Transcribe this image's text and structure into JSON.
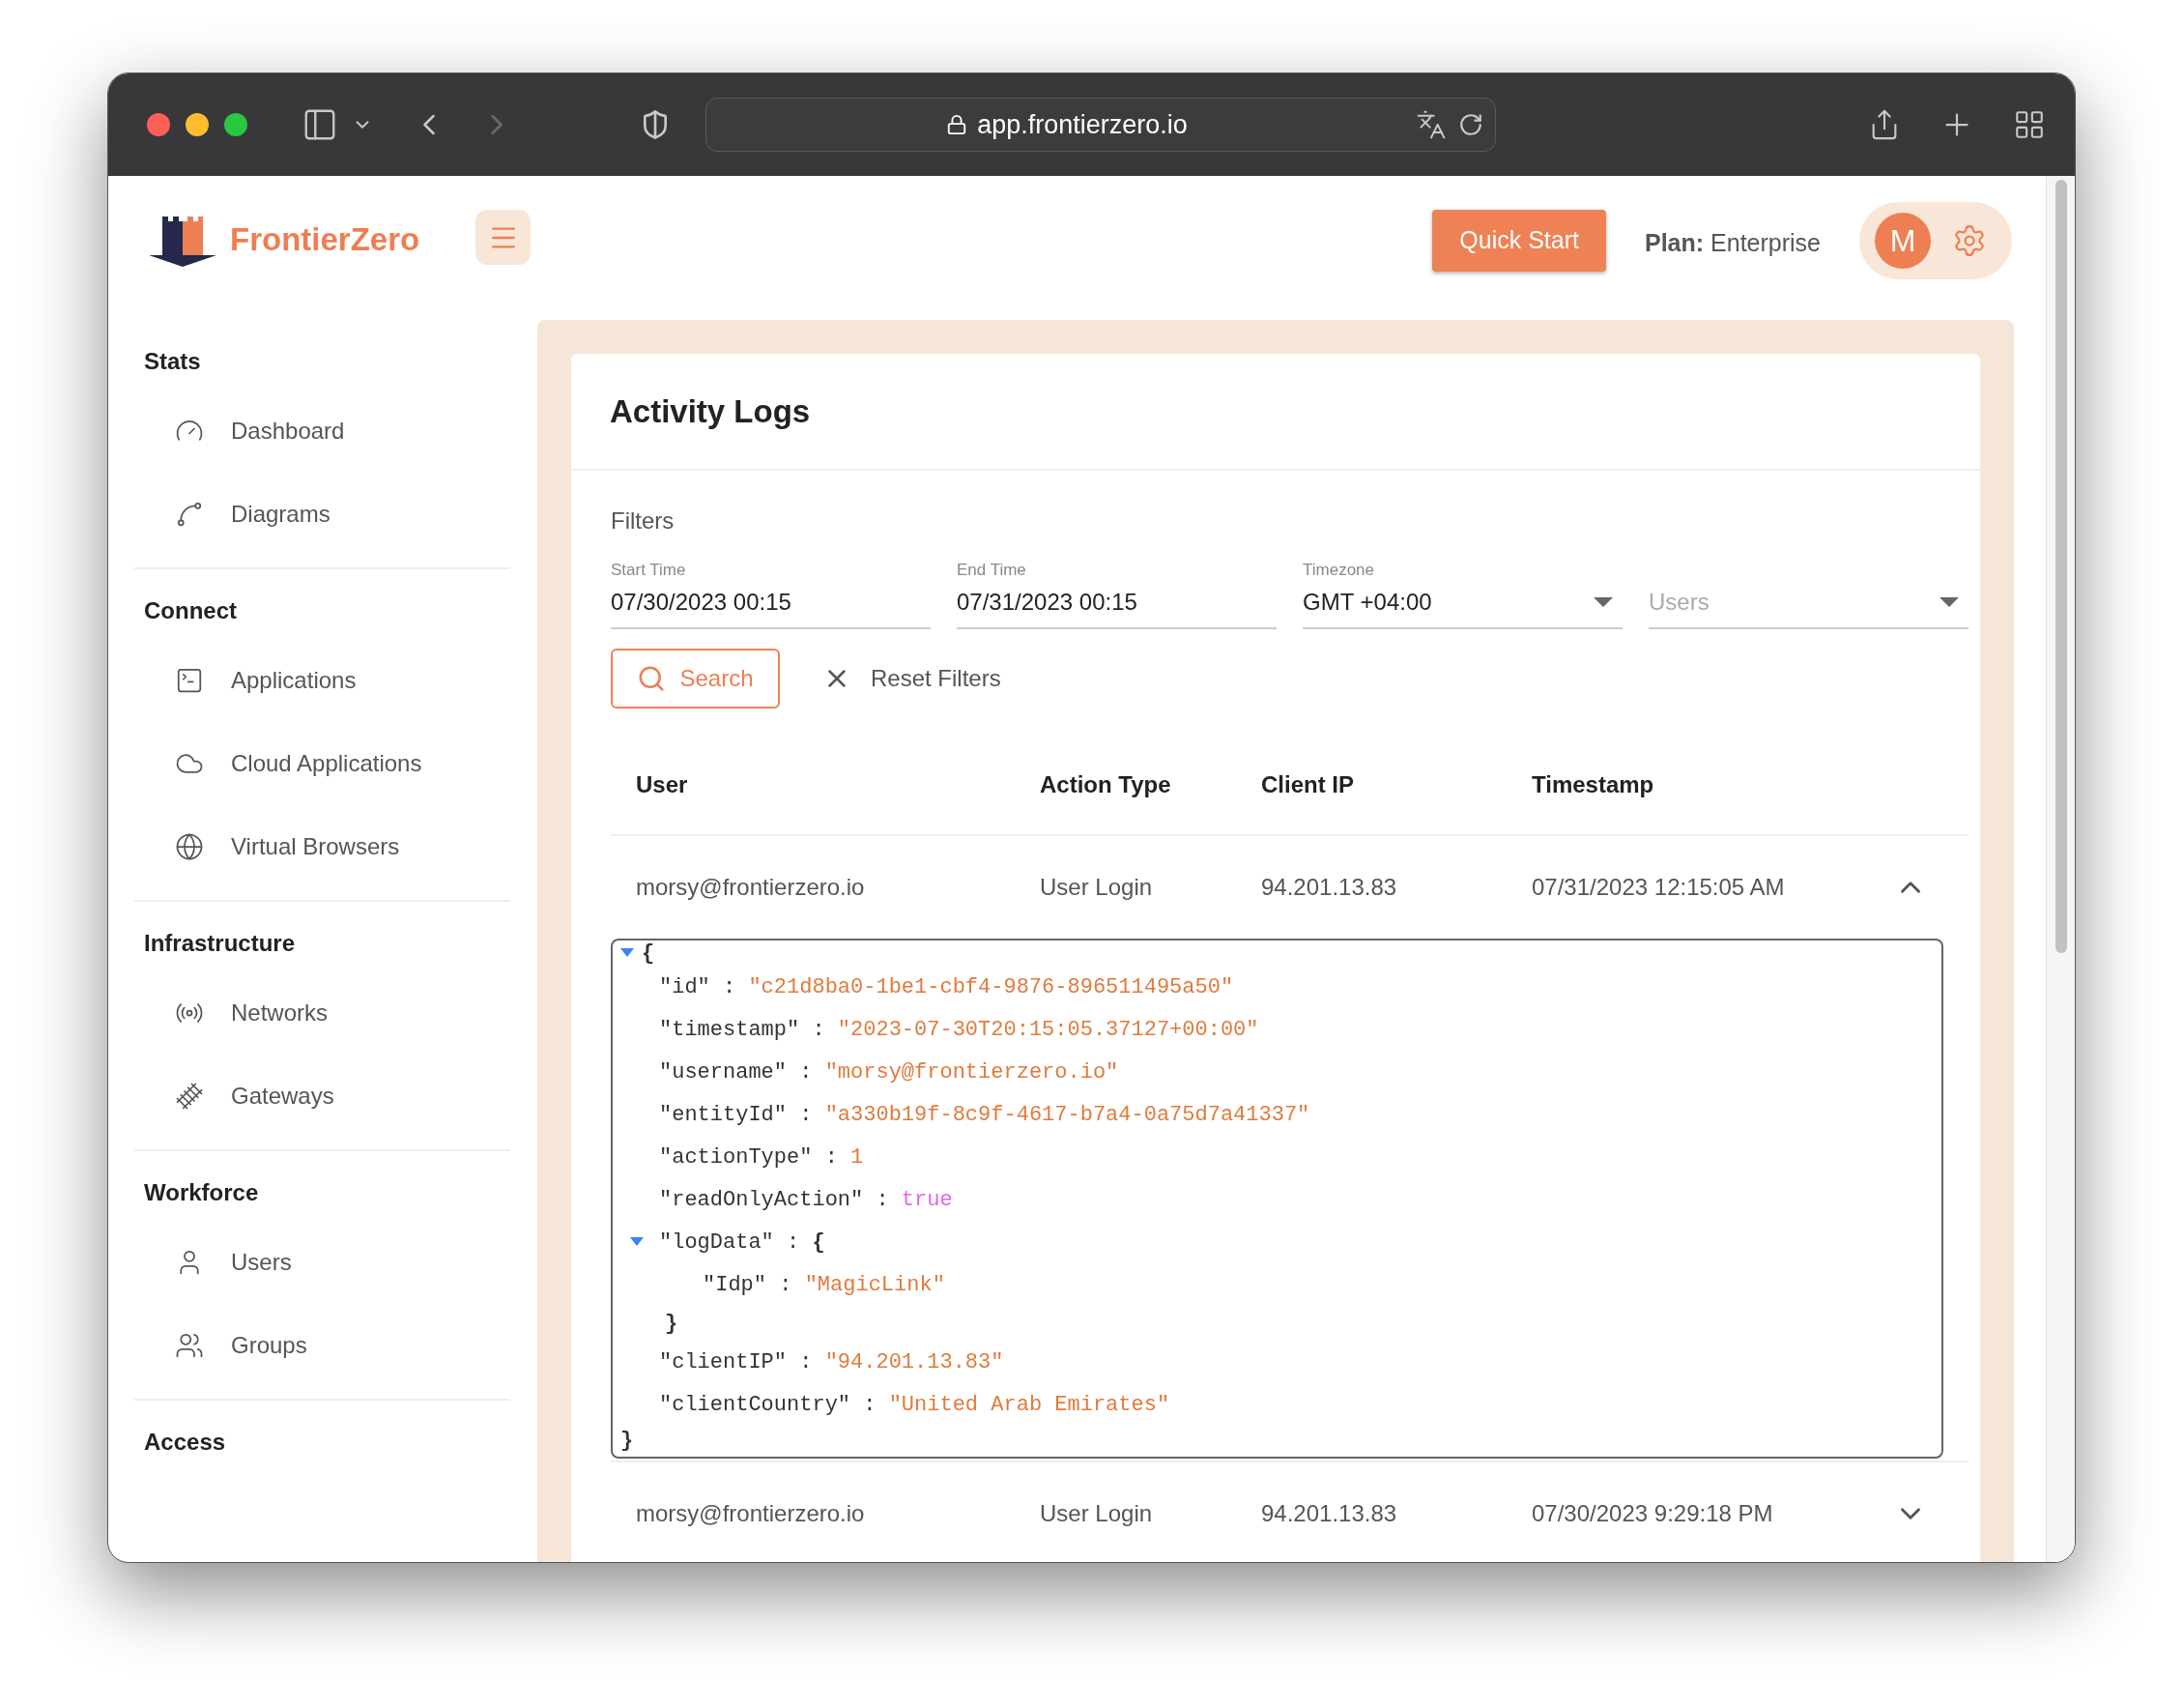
{
  "browser": {
    "url": "app.frontierzero.io"
  },
  "header": {
    "brand": "FrontierZero",
    "quick_start": "Quick Start",
    "plan": "**Plan:** Enterprise",
    "avatar": "M"
  },
  "sidebar": {
    "sections": [
      {
        "title": "Stats",
        "items": [
          "Dashboard",
          "Diagrams"
        ]
      },
      {
        "title": "Connect",
        "items": [
          "Applications",
          "Cloud Applications",
          "Virtual Browsers"
        ]
      },
      {
        "title": "Infrastructure",
        "items": [
          "Networks",
          "Gateways"
        ]
      },
      {
        "title": "Workforce",
        "items": [
          "Users",
          "Groups"
        ]
      },
      {
        "title": "Access"
      }
    ]
  },
  "page": {
    "title": "Activity Logs",
    "filters": {
      "title": "Filters",
      "fields": [
        {
          "kind": "text",
          "label": "Start Time",
          "value": "07/30/2023 00:15"
        },
        {
          "kind": "text",
          "label": "End Time",
          "value": "07/31/2023 00:15"
        },
        {
          "kind": "select",
          "label": "Timezone",
          "value": "GMT +04:00"
        },
        {
          "kind": "select",
          "placeholder": "Users"
        }
      ],
      "search": "Search",
      "reset": "Reset Filters"
    },
    "table": {
      "columns": [
        "User",
        "Action Type",
        "Client IP",
        "Timestamp"
      ],
      "rows": [
        {
          "cells": [
            "morsy@frontierzero.io",
            "User Login",
            "94.201.13.83",
            "07/31/2023 12:15:05 AM"
          ],
          "expanded": true,
          "json": {
            "open": "{",
            "close": "}",
            "separator": ":",
            "expanded": true,
            "entries": [
              {
                "key": "\"id\"",
                "kind": "string",
                "value": "\"c21d8ba0-1be1-cbf4-9876-896511495a50\""
              },
              {
                "key": "\"timestamp\"",
                "kind": "string",
                "value": "\"2023-07-30T20:15:05.37127+00:00\""
              },
              {
                "key": "\"username\"",
                "kind": "string",
                "value": "\"morsy@frontierzero.io\""
              },
              {
                "key": "\"entityId\"",
                "kind": "string",
                "value": "\"a330b19f-8c9f-4617-b7a4-0a75d7a41337\""
              },
              {
                "key": "\"actionType\"",
                "kind": "number",
                "value": "1"
              },
              {
                "key": "\"readOnlyAction\"",
                "kind": "boolean",
                "value": "true"
              },
              {
                "key": "\"logData\"",
                "kind": "object",
                "open": "{",
                "close": "}",
                "expanded": true,
                "children": [
                  {
                    "key": "\"Idp\"",
                    "kind": "string",
                    "value": "\"MagicLink\""
                  }
                ]
              },
              {
                "key": "\"clientIP\"",
                "kind": "string",
                "value": "\"94.201.13.83\""
              },
              {
                "key": "\"clientCountry\"",
                "kind": "string",
                "value": "\"United Arab Emirates\""
              }
            ]
          }
        },
        {
          "cells": [
            "morsy@frontierzero.io",
            "User Login",
            "94.201.13.83",
            "07/30/2023 9:29:18 PM"
          ],
          "expanded": false
        }
      ]
    }
  }
}
